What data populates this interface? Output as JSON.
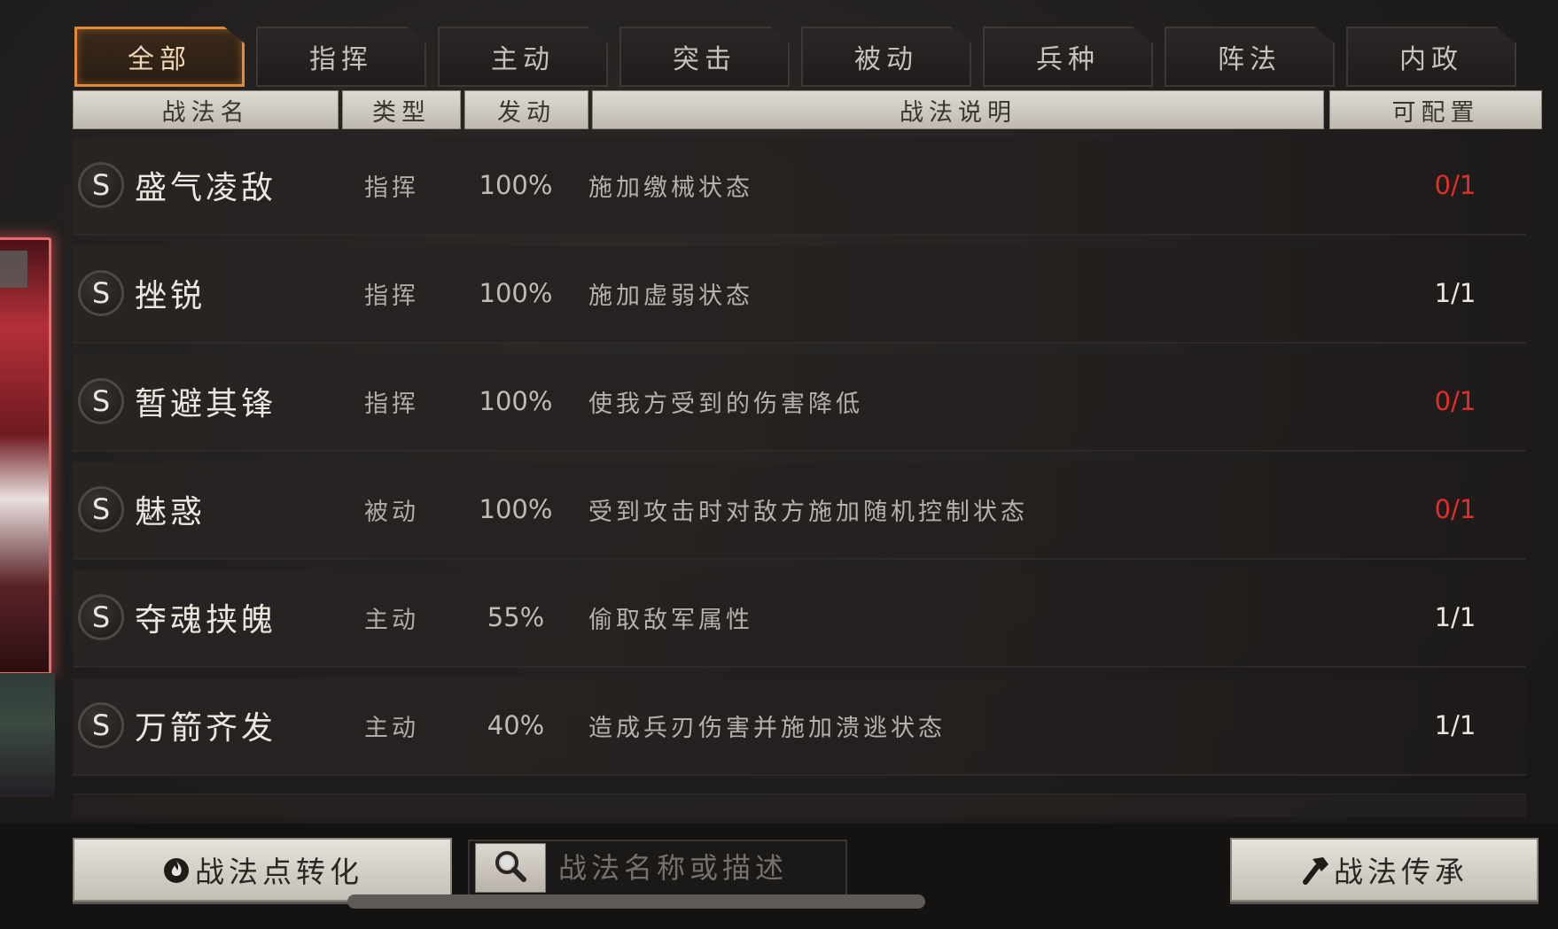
{
  "tabs": [
    {
      "label": "全部",
      "active": true
    },
    {
      "label": "指挥",
      "active": false
    },
    {
      "label": "主动",
      "active": false
    },
    {
      "label": "突击",
      "active": false
    },
    {
      "label": "被动",
      "active": false
    },
    {
      "label": "兵种",
      "active": false
    },
    {
      "label": "阵法",
      "active": false
    },
    {
      "label": "内政",
      "active": false
    }
  ],
  "table": {
    "headers": {
      "name": "战法名",
      "type": "类型",
      "rate": "发动",
      "desc": "战法说明",
      "config": "可配置"
    },
    "rows": [
      {
        "grade": "S",
        "name": "盛气凌敌",
        "type": "指挥",
        "rate": "100%",
        "desc": "施加缴械状态",
        "config": "0/1",
        "config_full": true
      },
      {
        "grade": "S",
        "name": "挫锐",
        "type": "指挥",
        "rate": "100%",
        "desc": "施加虚弱状态",
        "config": "1/1",
        "config_full": false
      },
      {
        "grade": "S",
        "name": "暂避其锋",
        "type": "指挥",
        "rate": "100%",
        "desc": "使我方受到的伤害降低",
        "config": "0/1",
        "config_full": true
      },
      {
        "grade": "S",
        "name": "魅惑",
        "type": "被动",
        "rate": "100%",
        "desc": "受到攻击时对敌方施加随机控制状态",
        "config": "0/1",
        "config_full": true
      },
      {
        "grade": "S",
        "name": "夺魂挟魄",
        "type": "主动",
        "rate": "55%",
        "desc": "偷取敌军属性",
        "config": "1/1",
        "config_full": false
      },
      {
        "grade": "S",
        "name": "万箭齐发",
        "type": "主动",
        "rate": "40%",
        "desc": "造成兵刃伤害并施加溃逃状态",
        "config": "1/1",
        "config_full": false
      }
    ]
  },
  "bottom": {
    "convert_label": "战法点转化",
    "search_placeholder": "战法名称或描述",
    "inherit_label": "战法传承"
  },
  "colors": {
    "accent": "#e08a3a",
    "unavailable": "#e32d2d",
    "header_bg": "#d1ccc5"
  },
  "icons": {
    "convert": "flame-icon",
    "search": "magnifier-icon",
    "inherit": "hammer-icon"
  }
}
